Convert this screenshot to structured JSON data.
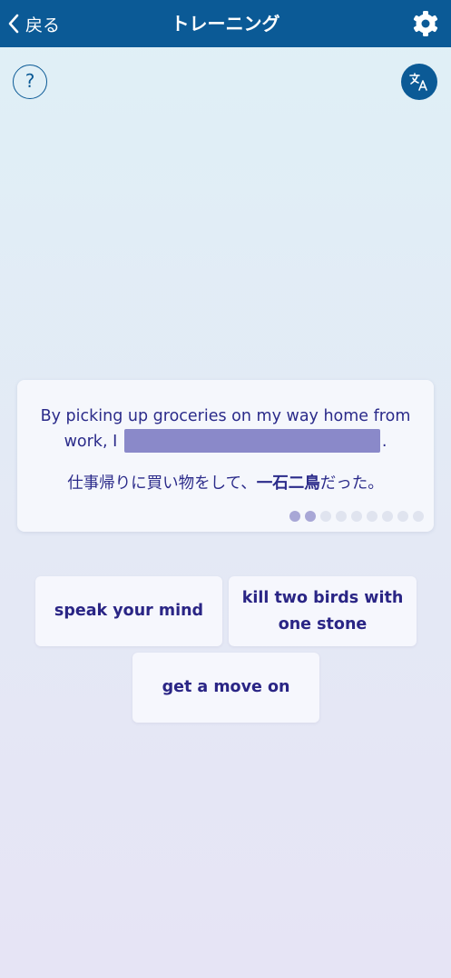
{
  "header": {
    "back_label": "戻る",
    "title": "トレーニング"
  },
  "help_button": {
    "label": "?"
  },
  "question": {
    "sentence_before": "By picking up groceries on my way home from work, I",
    "sentence_after": ".",
    "translation_before": "仕事帰りに買い物をして、",
    "translation_highlight": "一石二鳥",
    "translation_after": "だった。",
    "progress": {
      "total": 9,
      "completed": 2
    }
  },
  "choices": [
    {
      "label": "speak your mind"
    },
    {
      "label": "kill two birds with one stone"
    },
    {
      "label": "get a move on"
    }
  ],
  "colors": {
    "header_bg": "#0b5a96",
    "text_primary": "#2b2b8a",
    "blank_fill": "#8a89c9",
    "dot_active": "#a8a7d6",
    "dot_inactive": "#e0e4ef"
  },
  "icons": {
    "back": "chevron-left-icon",
    "settings": "gear-icon",
    "translate": "translate-icon"
  }
}
